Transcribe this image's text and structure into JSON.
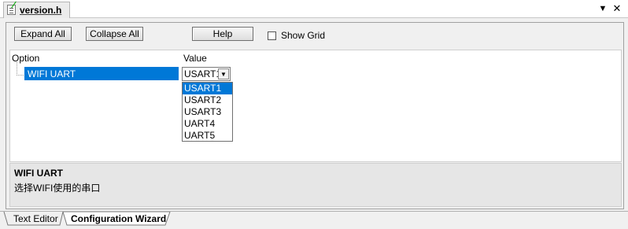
{
  "document_tab": {
    "label": "version.h",
    "icon": "file-header-icon"
  },
  "window_controls": {
    "dropdown_icon": "chevron-down-icon",
    "close_icon": "close-icon"
  },
  "toolbar": {
    "expand_all_label": "Expand All",
    "collapse_all_label": "Collapse All",
    "help_label": "Help",
    "show_grid_label": "Show Grid",
    "show_grid_checked": false
  },
  "grid": {
    "columns": [
      "Option",
      "Value"
    ],
    "rows": [
      {
        "option": "WIFI UART",
        "value": "USART1"
      }
    ]
  },
  "dropdown": {
    "options": [
      "USART1",
      "USART2",
      "USART3",
      "UART4",
      "UART5"
    ],
    "selected": "USART1"
  },
  "description": {
    "title": "WIFI UART",
    "text": "选择WIFI使用的串口"
  },
  "bottom_tabs": [
    {
      "label": "Text Editor",
      "active": false
    },
    {
      "label": "Configuration Wizard",
      "active": true
    }
  ],
  "colors": {
    "selection": "#0078d7",
    "panel_bg": "#f0f0f0",
    "desc_bg": "#e6e6e6"
  }
}
